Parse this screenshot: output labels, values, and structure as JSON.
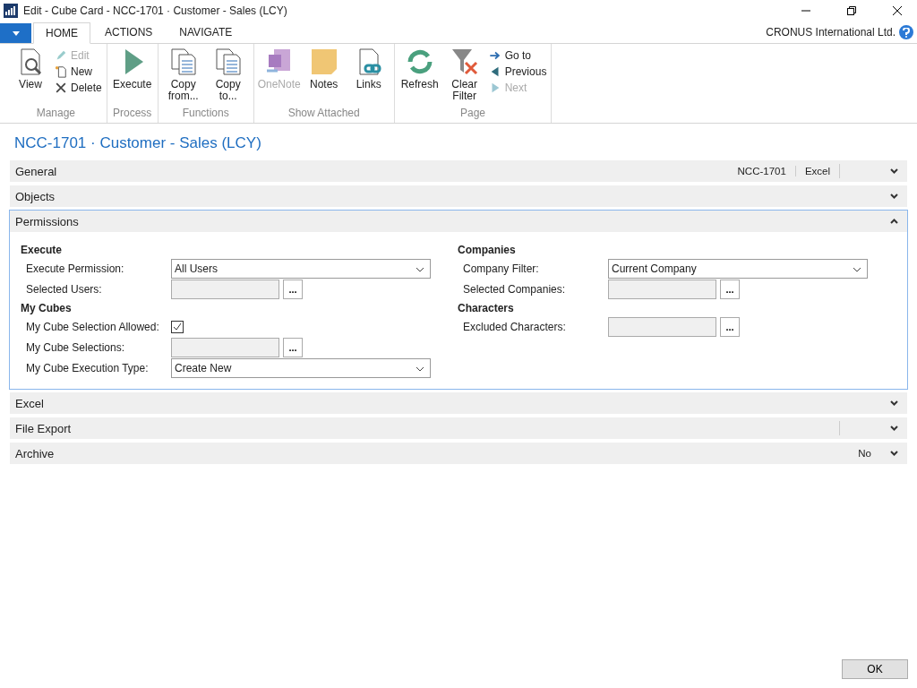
{
  "window": {
    "title": "Edit - Cube Card - NCC-1701 · Customer - Sales (LCY)"
  },
  "ribbon": {
    "tabs": [
      {
        "label": "HOME",
        "selected": true
      },
      {
        "label": "ACTIONS",
        "selected": false
      },
      {
        "label": "NAVIGATE",
        "selected": false
      }
    ],
    "company": "CRONUS International Ltd.",
    "groups": [
      {
        "label": "Manage",
        "items": [
          {
            "label": "View",
            "kind": "view",
            "disabled": false
          },
          {
            "stack": [
              {
                "label": "Edit",
                "kind": "edit",
                "disabled": true
              },
              {
                "label": "New",
                "kind": "new",
                "disabled": false
              },
              {
                "label": "Delete",
                "kind": "delete",
                "disabled": false
              }
            ]
          }
        ]
      },
      {
        "label": "Process",
        "items": [
          {
            "label": "Execute",
            "kind": "execute",
            "disabled": false
          }
        ]
      },
      {
        "label": "Functions",
        "items": [
          {
            "label": "Copy from...",
            "kind": "copy",
            "disabled": false
          },
          {
            "label": "Copy to...",
            "kind": "copy",
            "disabled": false
          }
        ]
      },
      {
        "label": "Show Attached",
        "items": [
          {
            "label": "OneNote",
            "kind": "onenote",
            "disabled": true
          },
          {
            "label": "Notes",
            "kind": "notes",
            "disabled": false
          },
          {
            "label": "Links",
            "kind": "links",
            "disabled": false
          }
        ]
      },
      {
        "label": "Page",
        "items": [
          {
            "label": "Refresh",
            "kind": "refresh",
            "disabled": false
          },
          {
            "label": "Clear Filter",
            "kind": "filter",
            "disabled": false
          },
          {
            "stack": [
              {
                "label": "Go to",
                "kind": "goto",
                "disabled": false
              },
              {
                "label": "Previous",
                "kind": "previous",
                "disabled": false
              },
              {
                "label": "Next",
                "kind": "next",
                "disabled": true
              }
            ]
          }
        ]
      }
    ]
  },
  "page_title": "NCC-1701 · Customer - Sales (LCY)",
  "sections": [
    {
      "title": "General",
      "expanded": false,
      "summary": [
        "NCC-1701",
        "Excel"
      ],
      "empty_slot": true
    },
    {
      "title": "Objects",
      "expanded": false
    },
    {
      "title": "Permissions",
      "expanded": true,
      "columns": [
        [
          {
            "heading": "Execute",
            "fields": [
              {
                "label": "Execute Permission:",
                "kind": "dropdown",
                "value": "All Users"
              },
              {
                "label": "Selected Users:",
                "kind": "lookup",
                "button": "..."
              }
            ]
          },
          {
            "heading": "My Cubes",
            "fields": [
              {
                "label": "My Cube Selection Allowed:",
                "kind": "checkbox",
                "checked": true
              },
              {
                "label": "My Cube Selections:",
                "kind": "lookup",
                "button": "..."
              },
              {
                "label": "My Cube Execution Type:",
                "kind": "dropdown",
                "value": "Create New"
              }
            ]
          }
        ],
        [
          {
            "heading": "Companies",
            "fields": [
              {
                "label": "Company Filter:",
                "kind": "dropdown",
                "value": "Current Company"
              },
              {
                "label": "Selected Companies:",
                "kind": "lookup",
                "button": "..."
              }
            ]
          },
          {
            "heading": "Characters",
            "fields": [
              {
                "label": "Excluded Characters:",
                "kind": "lookup",
                "button": "..."
              }
            ]
          }
        ]
      ]
    },
    {
      "title": "Excel",
      "expanded": false
    },
    {
      "title": "File Export",
      "expanded": false,
      "empty_slot": true
    },
    {
      "title": "Archive",
      "expanded": false,
      "summary": [
        "No"
      ]
    }
  ],
  "buttons": [
    "OK"
  ]
}
